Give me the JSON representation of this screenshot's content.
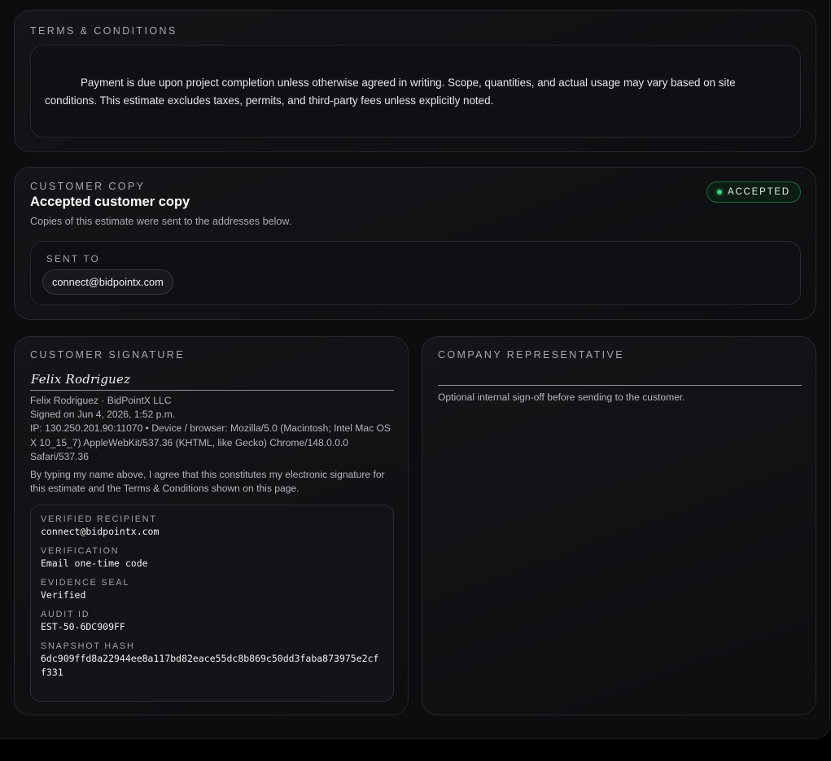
{
  "terms": {
    "heading": "TERMS & CONDITIONS",
    "body": "Payment is due upon project completion unless otherwise agreed in writing. Scope, quantities, and actual usage may vary based on site conditions. This estimate excludes taxes, permits, and third-party fees unless explicitly noted."
  },
  "customer_copy": {
    "eyebrow": "CUSTOMER COPY",
    "title": "Accepted customer copy",
    "description": "Copies of this estimate were sent to the addresses below.",
    "status_badge": "ACCEPTED",
    "status_color": "#3ed07a",
    "sent_to_label": "SENT TO",
    "recipients": [
      "connect@bidpointx.com"
    ]
  },
  "customer_signature": {
    "heading": "CUSTOMER SIGNATURE",
    "signature_text": "Felix Rodriguez",
    "signer_line": "Felix Rodriguez · BidPointX LLC",
    "signed_on": "Signed on Jun 4, 2026, 1:52 p.m.",
    "device_info": "IP: 130.250.201.90:11070 • Device / browser: Mozilla/5.0 (Macintosh; Intel Mac OS X 10_15_7) AppleWebKit/537.36 (KHTML, like Gecko) Chrome/148.0.0.0 Safari/537.36",
    "consent": "By typing my name above, I agree that this constitutes my electronic signature for this estimate and the Terms & Conditions shown on this page.",
    "evidence": [
      {
        "label": "VERIFIED RECIPIENT",
        "value": "connect@bidpointx.com"
      },
      {
        "label": "VERIFICATION",
        "value": "Email one-time code"
      },
      {
        "label": "EVIDENCE SEAL",
        "value": "Verified"
      },
      {
        "label": "AUDIT ID",
        "value": "EST-50-6DC909FF"
      },
      {
        "label": "SNAPSHOT HASH",
        "value": "6dc909ffd8a22944ee8a117bd82eace55dc8b869c50dd3faba873975e2cff331"
      }
    ]
  },
  "company_representative": {
    "heading": "COMPANY REPRESENTATIVE",
    "note": "Optional internal sign-off before sending to the customer."
  }
}
